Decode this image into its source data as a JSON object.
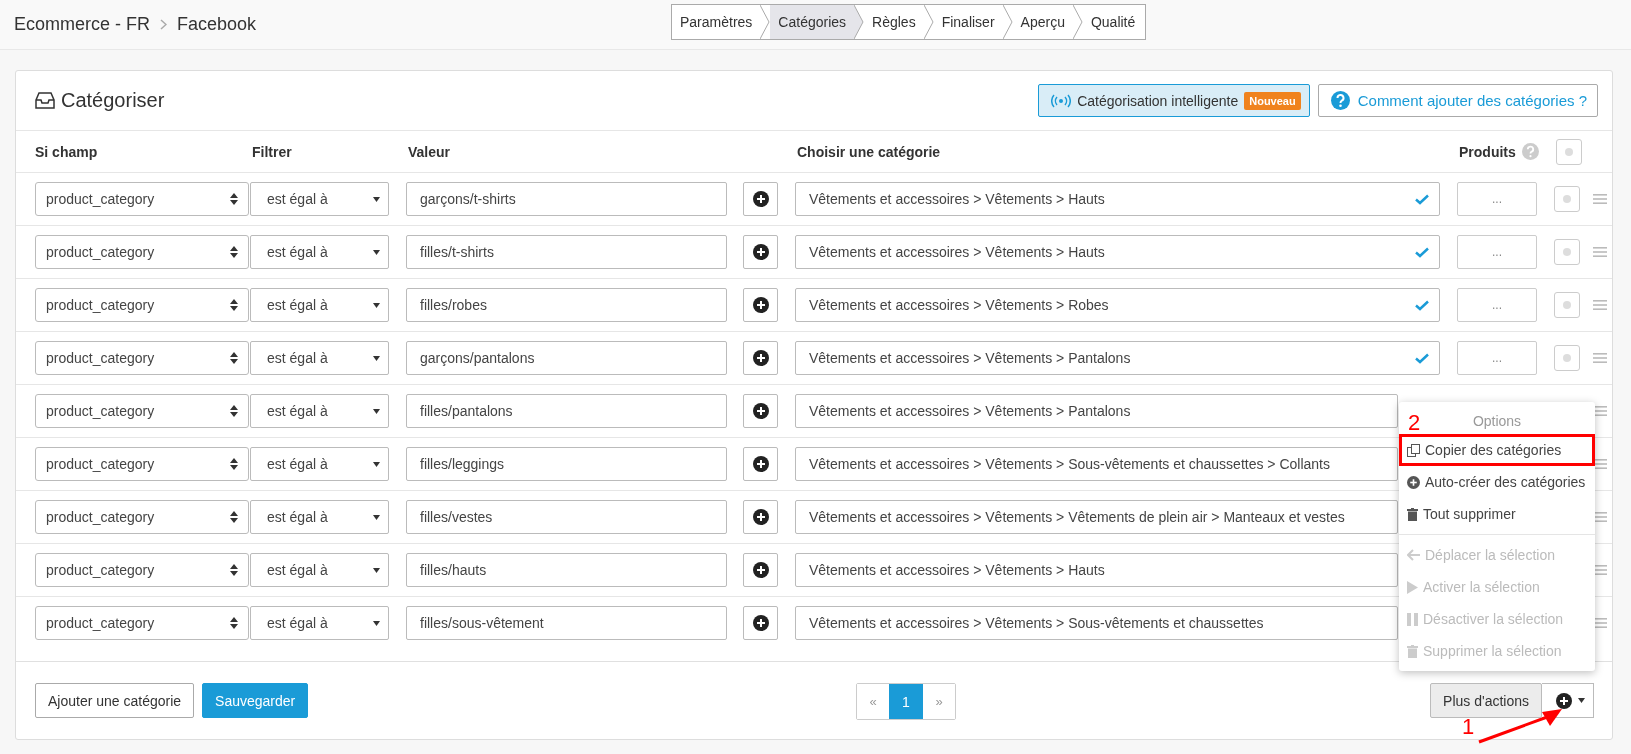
{
  "breadcrumb": [
    "Ecommerce - FR",
    "Facebook"
  ],
  "steps": [
    {
      "label": "Paramètres",
      "selected": false
    },
    {
      "label": "Catégories",
      "selected": true
    },
    {
      "label": "Règles",
      "selected": false
    },
    {
      "label": "Finaliser",
      "selected": false
    },
    {
      "label": "Aperçu",
      "selected": false
    },
    {
      "label": "Qualité",
      "selected": false
    }
  ],
  "card": {
    "title": "Catégoriser",
    "smart_button": {
      "label": "Catégorisation intelligente",
      "badge": "Nouveau"
    },
    "help_link": "Comment ajouter des catégories ?"
  },
  "table": {
    "columns": [
      "Si champ",
      "Filtrer",
      "Valeur",
      "Choisir une catégorie",
      "Produits"
    ],
    "select_all": {
      "checked": false
    },
    "rows": [
      {
        "field": "product_category",
        "filter": "est égal à",
        "value": "garçons/t-shirts",
        "category": "Vêtements et accessoires > Vêtements > Hauts",
        "matched": true,
        "products": "...",
        "checked": false
      },
      {
        "field": "product_category",
        "filter": "est égal à",
        "value": "filles/t-shirts",
        "category": "Vêtements et accessoires > Vêtements > Hauts",
        "matched": true,
        "products": "...",
        "checked": false
      },
      {
        "field": "product_category",
        "filter": "est égal à",
        "value": "filles/robes",
        "category": "Vêtements et accessoires > Vêtements > Robes",
        "matched": true,
        "products": "...",
        "checked": false
      },
      {
        "field": "product_category",
        "filter": "est égal à",
        "value": "garçons/pantalons",
        "category": "Vêtements et accessoires > Vêtements > Pantalons",
        "matched": true,
        "products": "...",
        "checked": false
      },
      {
        "field": "product_category",
        "filter": "est égal à",
        "value": "filles/pantalons",
        "category": "Vêtements et accessoires > Vêtements > Pantalons"
      },
      {
        "field": "product_category",
        "filter": "est égal à",
        "value": "filles/leggings",
        "category": "Vêtements et accessoires > Vêtements > Sous-vêtements et chaussettes > Collants"
      },
      {
        "field": "product_category",
        "filter": "est égal à",
        "value": "filles/vestes",
        "category": "Vêtements et accessoires > Vêtements > Vêtements de plein air > Manteaux et vestes"
      },
      {
        "field": "product_category",
        "filter": "est égal à",
        "value": "filles/hauts",
        "category": "Vêtements et accessoires > Vêtements > Hauts"
      },
      {
        "field": "product_category",
        "filter": "est égal à",
        "value": "filles/sous-vêtement",
        "category": "Vêtements et accessoires > Vêtements > Sous-vêtements et chaussettes"
      }
    ]
  },
  "footer": {
    "add_button": "Ajouter une catégorie",
    "save_button": "Sauvegarder",
    "pagination": [
      {
        "label": "«",
        "selected": false
      },
      {
        "label": "1",
        "selected": true
      },
      {
        "label": "»",
        "selected": false
      }
    ],
    "more_actions": "Plus d'actions"
  },
  "menu": {
    "header": "Options",
    "items": [
      {
        "kind": "copy",
        "label": "Copier des catégories",
        "disabled": false,
        "highlighted": true
      },
      {
        "kind": "plus",
        "label": "Auto-créer des catégories",
        "disabled": false,
        "highlighted": false
      },
      {
        "kind": "trash",
        "label": "Tout supprimer",
        "disabled": false,
        "highlighted": false
      },
      {
        "kind": "divider"
      },
      {
        "kind": "arrow",
        "label": "Déplacer la sélection",
        "disabled": true,
        "highlighted": false
      },
      {
        "kind": "play",
        "label": "Activer la sélection",
        "disabled": true,
        "highlighted": false
      },
      {
        "kind": "pause",
        "label": "Désactiver la sélection",
        "disabled": true,
        "highlighted": false
      },
      {
        "kind": "trash",
        "label": "Supprimer la sélection",
        "disabled": true,
        "highlighted": false
      }
    ]
  },
  "annotations": [
    "1",
    "2"
  ]
}
